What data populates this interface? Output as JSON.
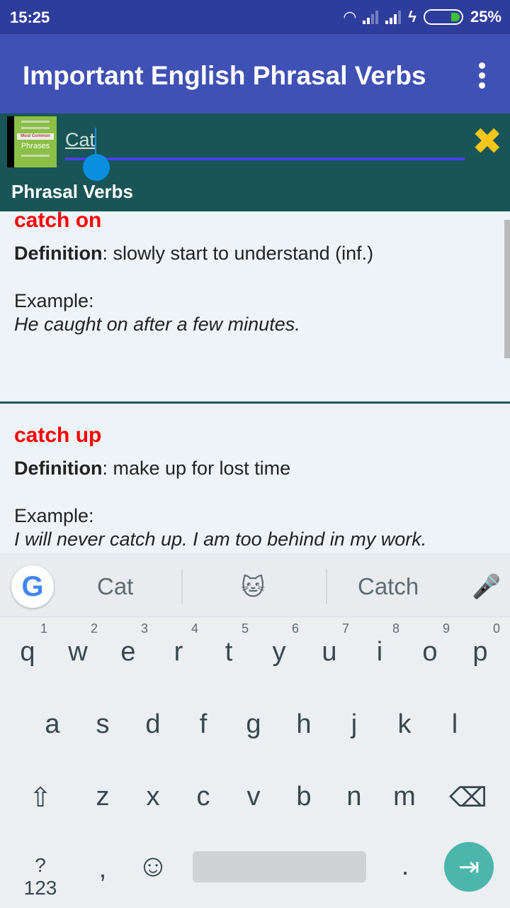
{
  "status": {
    "time": "15:25",
    "battery": "25%",
    "battery_level": 25
  },
  "appbar": {
    "title": "Important English Phrasal Verbs"
  },
  "search": {
    "logo_top": "Most Common",
    "logo_text": "Phrases",
    "value": "Cat",
    "category": "Phrasal Verbs",
    "close_icon": "close-x-icon"
  },
  "entries": [
    {
      "phrase": "catch on",
      "def_label": "Definition",
      "definition": ": slowly start to understand (inf.)",
      "ex_label": "Example:",
      "example": "He caught on after a few minutes."
    },
    {
      "phrase": "catch up",
      "def_label": "Definition",
      "definition": ": make up for lost time",
      "ex_label": "Example:",
      "example": "I will never catch up. I am too behind in my work."
    }
  ],
  "keyboard": {
    "suggestions": [
      "Cat",
      "🐱",
      "Catch"
    ],
    "row1": [
      [
        "q",
        "1"
      ],
      [
        "w",
        "2"
      ],
      [
        "e",
        "3"
      ],
      [
        "r",
        "4"
      ],
      [
        "t",
        "5"
      ],
      [
        "y",
        "6"
      ],
      [
        "u",
        "7"
      ],
      [
        "i",
        "8"
      ],
      [
        "o",
        "9"
      ],
      [
        "p",
        "0"
      ]
    ],
    "row2": [
      "a",
      "s",
      "d",
      "f",
      "g",
      "h",
      "j",
      "k",
      "l"
    ],
    "row3": [
      "z",
      "x",
      "c",
      "v",
      "b",
      "n",
      "m"
    ],
    "symbols": "?123",
    "comma": ",",
    "period": ".",
    "shift": "⇧",
    "backspace": "⌫",
    "enter": "⇥",
    "emoji": "☺",
    "mic": "🎤",
    "google": "G"
  },
  "colors": {
    "appbar": "#3f51b5",
    "status": "#2e3d9c",
    "search_bg": "#195456",
    "phrase": "#ff0000",
    "close": "#f5c518",
    "enter": "#4db6ac"
  }
}
